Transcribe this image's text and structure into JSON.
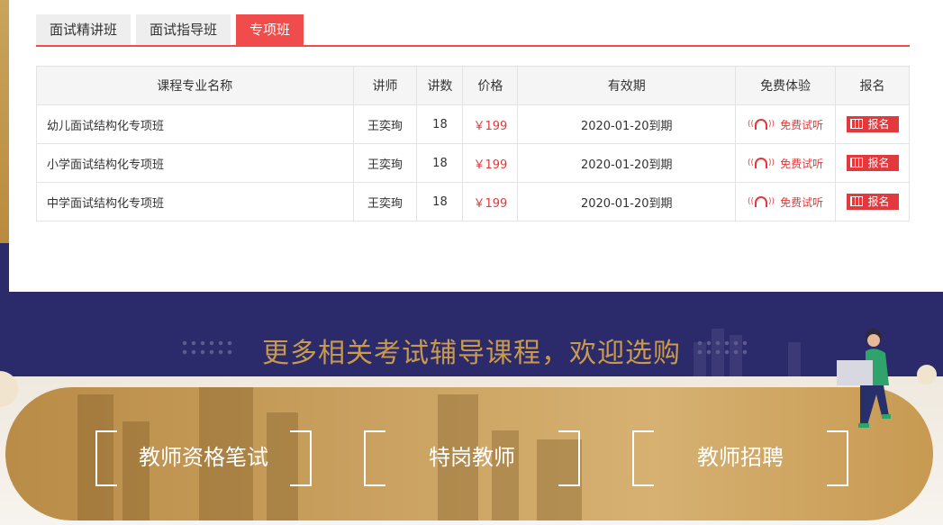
{
  "tabs": [
    {
      "label": "面试精讲班",
      "active": false
    },
    {
      "label": "面试指导班",
      "active": false
    },
    {
      "label": "专项班",
      "active": true
    }
  ],
  "table": {
    "headers": [
      "课程专业名称",
      "讲师",
      "讲数",
      "价格",
      "有效期",
      "免费体验",
      "报名"
    ],
    "rows": [
      {
        "name": "幼儿面试结构化专项班",
        "teacher": "王奕珣",
        "lessons": "18",
        "price": "￥199",
        "validity": "2020-01-20到期",
        "trial": "免费试听",
        "signup": "报名"
      },
      {
        "name": "小学面试结构化专项班",
        "teacher": "王奕珣",
        "lessons": "18",
        "price": "￥199",
        "validity": "2020-01-20到期",
        "trial": "免费试听",
        "signup": "报名"
      },
      {
        "name": "中学面试结构化专项班",
        "teacher": "王奕珣",
        "lessons": "18",
        "price": "￥199",
        "validity": "2020-01-20到期",
        "trial": "免费试听",
        "signup": "报名"
      }
    ]
  },
  "promo": {
    "title": "更多相关考试辅导课程，欢迎选购",
    "categories": [
      "教师资格笔试",
      "特岗教师",
      "教师招聘"
    ]
  },
  "colors": {
    "accent": "#f04c4c",
    "price": "#e3393c",
    "promo_title": "#c99a4c",
    "background": "#2b2a6b"
  },
  "icons": {
    "trial": "headphones-icon",
    "signup": "cart-icon"
  }
}
